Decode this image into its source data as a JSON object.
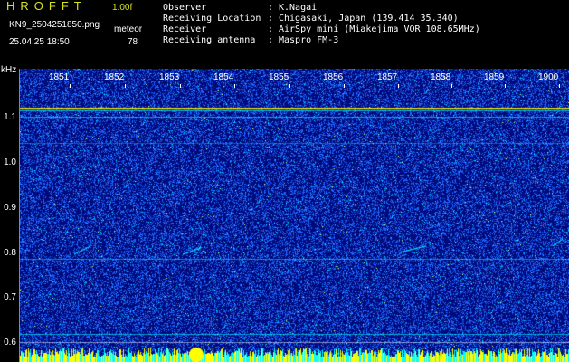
{
  "header": {
    "app_title": "HROFFT",
    "version": "1.00f",
    "file_name": "KN9_2504251850.png",
    "meteor_label": "meteor",
    "datetime": "25.04.25 18:50",
    "meteor_count": "78"
  },
  "info": [
    {
      "label": "Observer",
      "value": "K.Nagai"
    },
    {
      "label": "Receiving Location",
      "value": "Chigasaki, Japan (139.414 35.340)"
    },
    {
      "label": "Receiver",
      "value": "AirSpy mini (Miakejima VOR 108.65MHz)"
    },
    {
      "label": "Receiving antenna",
      "value": "Maspro FM-3"
    }
  ],
  "axis": {
    "unit": "kHz",
    "y_labels": [
      "1.1",
      "1.0",
      "0.9",
      "0.8",
      "0.7",
      "0.6"
    ],
    "x_labels": [
      "1851",
      "1852",
      "1853",
      "1854",
      "1855",
      "1856",
      "1857",
      "1858",
      "1859",
      "1900"
    ]
  },
  "colors": {
    "background": "#000a7a",
    "noise": "#1e64ff",
    "signal": "#00ffff",
    "strong": "#ffff00",
    "peak": "#ff3000",
    "title": "#d6e21c"
  }
}
